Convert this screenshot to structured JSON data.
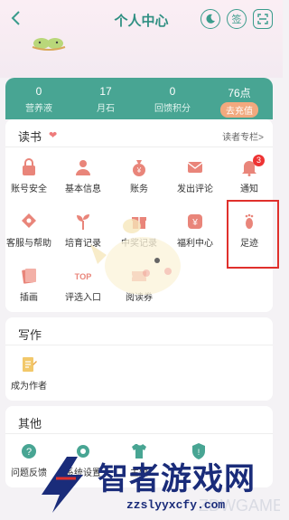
{
  "header": {
    "title": "个人中心",
    "night_icon": "moon-icon",
    "signin_label": "签",
    "scan_icon": "scan-icon"
  },
  "stats": [
    {
      "value": "0",
      "label": "营养液"
    },
    {
      "value": "17",
      "label": "月石"
    },
    {
      "value": "0",
      "label": "回馈积分"
    },
    {
      "value": "76点",
      "label": "去充值"
    }
  ],
  "reading": {
    "title": "读书",
    "link": "读者专栏>",
    "items": [
      {
        "label": "账号安全",
        "icon": "lock-icon"
      },
      {
        "label": "基本信息",
        "icon": "person-icon"
      },
      {
        "label": "账务",
        "icon": "money-bag-icon"
      },
      {
        "label": "发出评论",
        "icon": "mail-icon"
      },
      {
        "label": "通知",
        "icon": "bell-icon",
        "badge": "3"
      },
      {
        "label": "客服与帮助",
        "icon": "help-bubble-icon"
      },
      {
        "label": "培育记录",
        "icon": "sprout-icon"
      },
      {
        "label": "中奖记录",
        "icon": "gift-icon"
      },
      {
        "label": "福利中心",
        "icon": "coin-icon"
      },
      {
        "label": "足迹",
        "icon": "footprint-icon"
      },
      {
        "label": "插画",
        "icon": "illustration-icon"
      },
      {
        "label": "评选入口",
        "icon": "top-icon",
        "icon_text": "TOP"
      },
      {
        "label": "阅读券",
        "icon": "ticket-icon"
      }
    ]
  },
  "writing": {
    "title": "写作",
    "items": [
      {
        "label": "成为作者",
        "icon": "pencil-doc-icon"
      }
    ]
  },
  "other": {
    "title": "其他",
    "items": [
      {
        "label": "问题反馈",
        "icon": "question-icon"
      },
      {
        "label": "系统设置",
        "icon": "gear-icon"
      },
      {
        "label": "主题",
        "icon": "shirt-icon"
      },
      {
        "label": "",
        "icon": "shield-icon"
      }
    ]
  },
  "watermark": {
    "brand": "智者游戏网",
    "url": "zzslyyxcfy.com",
    "faint": "ZDWGAME"
  },
  "colors": {
    "accent": "#48a593",
    "title": "#2f8f82",
    "recharge": "#f2a97e",
    "badge": "#e33333",
    "highlight": "#e0302c"
  }
}
